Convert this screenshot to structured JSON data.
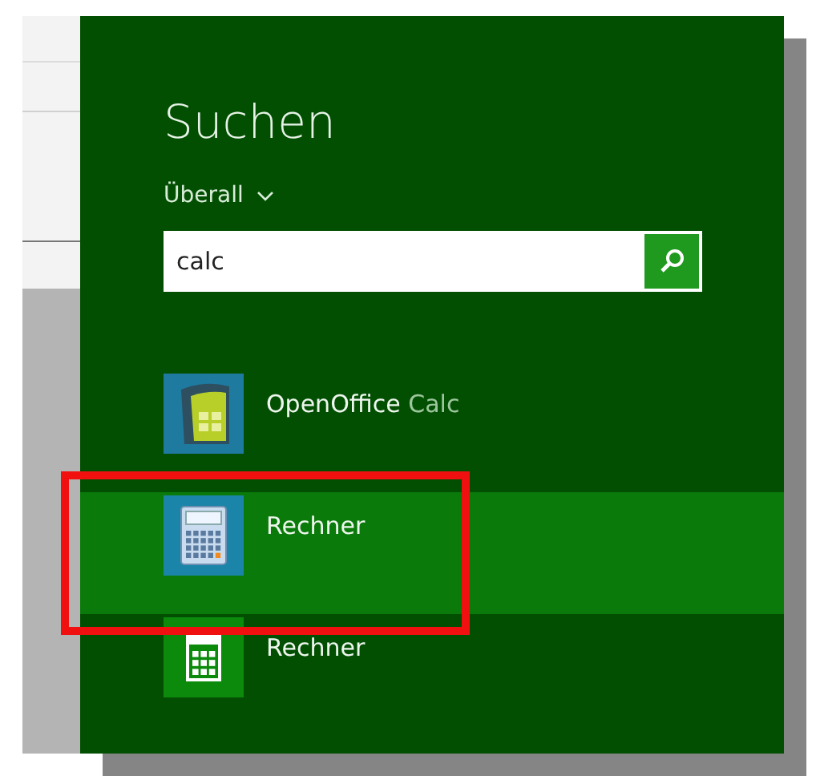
{
  "search_pane": {
    "title": "Suchen",
    "scope": "Überall",
    "query": "calc",
    "results": [
      {
        "name": "OpenOffice",
        "match": "Calc",
        "kind": "spreadsheet",
        "selected": false
      },
      {
        "name": "Rechner",
        "kind": "desktop",
        "selected": true
      },
      {
        "name": "Rechner",
        "kind": "tile",
        "selected": false
      }
    ]
  }
}
